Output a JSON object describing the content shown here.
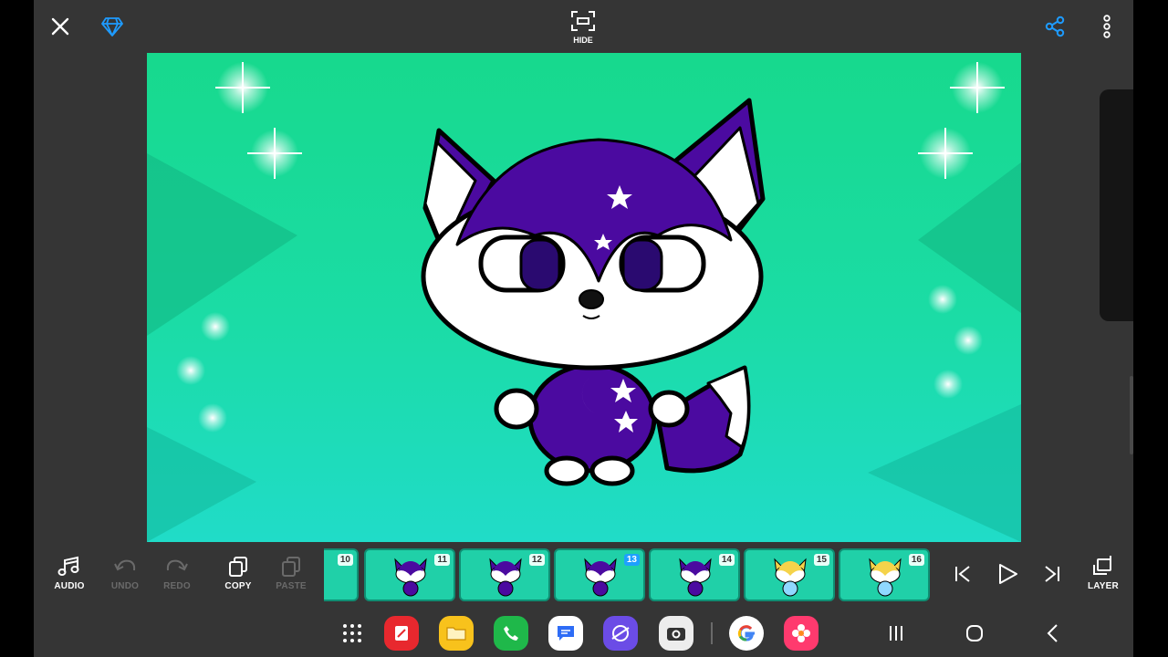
{
  "topbar": {
    "close_icon": "close-icon",
    "premium_icon": "diamond-icon",
    "hide_label": "HIDE",
    "share_icon": "share-icon",
    "more_icon": "more-vertical-icon",
    "accent": "#1e9bff"
  },
  "canvas": {
    "background_colors": [
      "#17d98d",
      "#20dcc8"
    ],
    "character_colors": [
      "#4b0aa0",
      "#ffffff"
    ]
  },
  "toolbar": {
    "audio": "AUDIO",
    "undo": "UNDO",
    "redo": "REDO",
    "copy": "COPY",
    "paste": "PASTE",
    "layer": "LAYER"
  },
  "frames": [
    {
      "number": "10",
      "thumbnail": "purple-fox"
    },
    {
      "number": "11",
      "thumbnail": "purple-fox"
    },
    {
      "number": "12",
      "thumbnail": "purple-fox"
    },
    {
      "number": "13",
      "thumbnail": "purple-fox",
      "current": true
    },
    {
      "number": "14",
      "thumbnail": "purple-fox"
    },
    {
      "number": "15",
      "thumbnail": "yellow-fox"
    },
    {
      "number": "16",
      "thumbnail": "yellow-fox"
    }
  ],
  "playback": {
    "first_icon": "skip-to-start-icon",
    "play_icon": "play-icon",
    "last_icon": "skip-to-end-icon"
  },
  "dock": {
    "apps": [
      "app-drawer",
      "flipnote",
      "files",
      "phone",
      "messages",
      "internet",
      "camera",
      "google",
      "gallery"
    ],
    "nav": [
      "recents",
      "home",
      "back"
    ]
  }
}
